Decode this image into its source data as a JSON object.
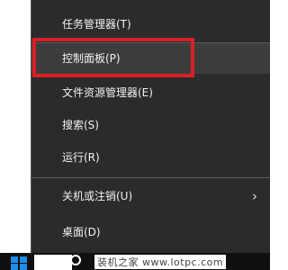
{
  "menu": {
    "items": [
      {
        "label": "任务管理器(T)"
      },
      {
        "label": "控制面板(P)"
      },
      {
        "label": "文件资源管理器(E)"
      },
      {
        "label": "搜索(S)"
      },
      {
        "label": "运行(R)"
      },
      {
        "label": "关机或注销(U)",
        "submenu_arrow": "›"
      },
      {
        "label": "桌面(D)"
      }
    ]
  },
  "highlight_color": "#d91f27",
  "menu_background": "#2b2b2b",
  "taskbar": {
    "watermark": "装机之家 www.lotpc.com"
  },
  "icons": {
    "start": "windows-start-icon",
    "search": "cortana-circle-icon",
    "submenu": "chevron-right-icon"
  }
}
